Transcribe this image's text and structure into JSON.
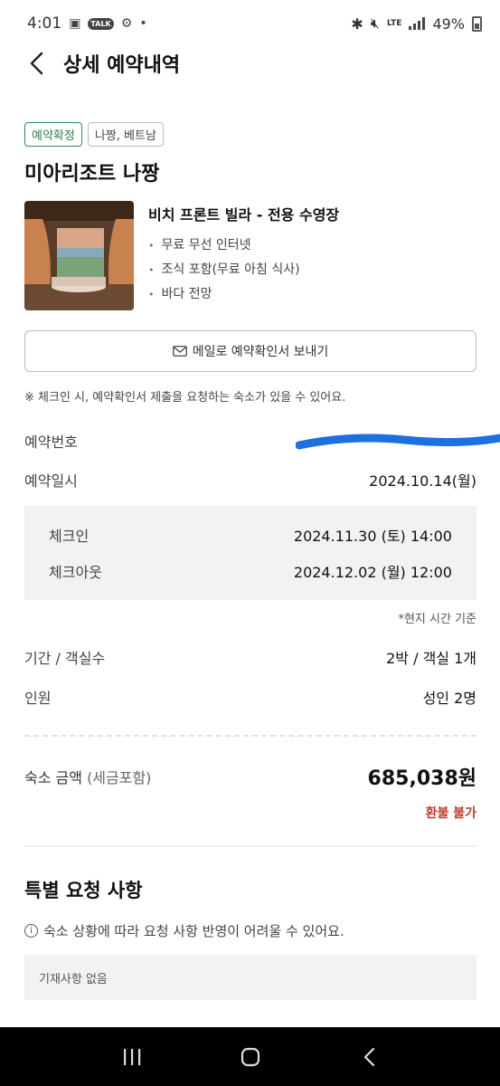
{
  "status_bar": {
    "time": "4:01",
    "talk": "TALK",
    "lte": "LTE",
    "battery": "49%"
  },
  "header": {
    "title": "상세 예약내역"
  },
  "tags": [
    "예약확정",
    "나짱, 베트남"
  ],
  "hotel_name": "미아리조트 나짱",
  "room": {
    "title": "비치 프론트 빌라 - 전용 수영장",
    "amenities": [
      "무료 무선 인터넷",
      "조식 포함(무료 아침 식사)",
      "바다 전망"
    ]
  },
  "email_button": "메일로 예약확인서 보내기",
  "note": "※ 체크인 시, 예약확인서 제출을 요청하는 숙소가 있을 수 있어요.",
  "reservation": {
    "number_label": "예약번호",
    "date_label": "예약일시",
    "date_value": "2024.10.14(월)"
  },
  "stay": {
    "checkin_label": "체크인",
    "checkin_value": "2024.11.30 (토) 14:00",
    "checkout_label": "체크아웃",
    "checkout_value": "2024.12.02 (월) 12:00"
  },
  "timezone_note": "*현지 시간 기준",
  "period": {
    "label": "기간 / 객실수",
    "value": "2박 / 객실 1개"
  },
  "people": {
    "label": "인원",
    "value": "성인 2명"
  },
  "price": {
    "label": "숙소 금액",
    "sub": "(세금포함)",
    "value": "685,038원",
    "refund": "환불 불가"
  },
  "special_request": {
    "title": "특별 요청 사항",
    "info": "숙소 상황에 따라 요청 사항 반영이 어려울 수 있어요.",
    "value": "기재사항 없음"
  },
  "colors": {
    "tag_green": "#2e7d4f",
    "refund_red": "#c0392b",
    "redaction_blue": "#1e6fe0"
  }
}
